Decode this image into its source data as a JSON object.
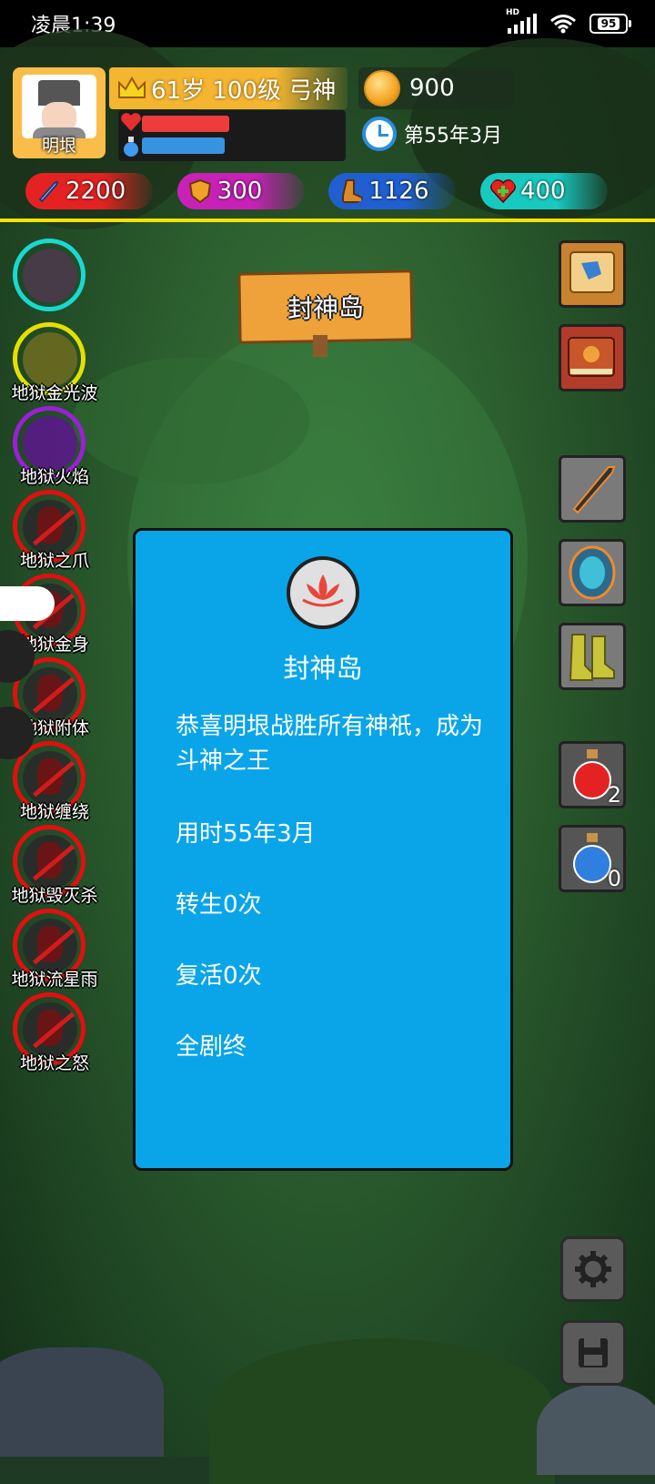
{
  "status_bar": {
    "time": "凌晨1:39",
    "network": "HD",
    "battery": "95"
  },
  "player": {
    "name": "明垠",
    "level_title": "61岁 100级 弓神",
    "hp_fraction": 0.4,
    "mp_fraction": 0.38
  },
  "resources": {
    "gold": "900",
    "date": "第55年3月"
  },
  "stats": {
    "attack": "2200",
    "defense": "300",
    "speed": "1126",
    "health": "400"
  },
  "location": "封神岛",
  "skills": [
    {
      "label": "",
      "color": "#1ad8d0"
    },
    {
      "label": "地狱金光波",
      "color": "#e5e000"
    },
    {
      "label": "地狱火焰",
      "color": "#9a1fd6"
    },
    {
      "label": "地狱之爪",
      "color": "#e01010"
    },
    {
      "label": "地狱金身",
      "color": "#e01010"
    },
    {
      "label": "地狱附体",
      "color": "#e01010"
    },
    {
      "label": "地狱缠绕",
      "color": "#e01010"
    },
    {
      "label": "地狱毁灭杀",
      "color": "#e01010"
    },
    {
      "label": "地狱流星雨",
      "color": "#e01010"
    },
    {
      "label": "地狱之怒",
      "color": "#e01010"
    }
  ],
  "inventory": {
    "red_potion_count": "2",
    "blue_potion_count": "0"
  },
  "dialog": {
    "title": "封神岛",
    "message": "恭喜明垠战胜所有神祇，成为斗神之王",
    "time_used": "用时55年3月",
    "rebirths": "转生0次",
    "revives": "复活0次",
    "ending": "全剧终"
  }
}
